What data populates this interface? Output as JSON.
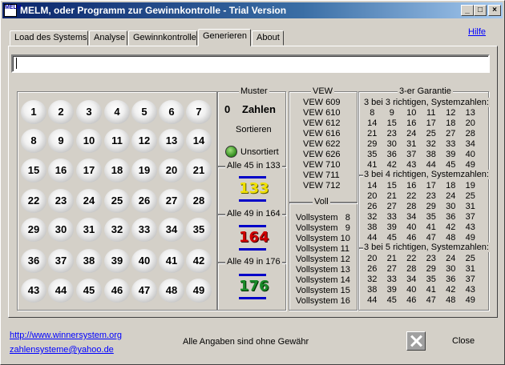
{
  "window": {
    "title": "MELM, oder Programm zur Gewinnkontrolle - Trial Version",
    "icon_text": "MELM",
    "controls": {
      "minimize": "_",
      "maximize": "□",
      "close": "×"
    }
  },
  "tabs": [
    "Load des Systems",
    "Analyse",
    "Gewinnkontrolle",
    "Generieren",
    "About"
  ],
  "active_tab": "Generieren",
  "help_link": "Hilfe",
  "input_value": "",
  "balls": [
    "1",
    "2",
    "3",
    "4",
    "5",
    "6",
    "7",
    "8",
    "9",
    "10",
    "11",
    "12",
    "13",
    "14",
    "15",
    "16",
    "17",
    "18",
    "19",
    "20",
    "21",
    "22",
    "23",
    "24",
    "25",
    "26",
    "27",
    "28",
    "29",
    "30",
    "31",
    "32",
    "33",
    "34",
    "35",
    "36",
    "37",
    "38",
    "39",
    "40",
    "41",
    "42",
    "43",
    "44",
    "45",
    "46",
    "47",
    "48",
    "49"
  ],
  "muster": {
    "header": "Muster",
    "count": "0",
    "count_label": "Zahlen",
    "sortieren": "Sortieren",
    "unsortiert": "Unsortiert",
    "sets": [
      {
        "label": "Alle 45 in 133",
        "badge": "133",
        "color": "#f0e000"
      },
      {
        "label": "Alle 49 in 164",
        "badge": "164",
        "color": "#d00000"
      },
      {
        "label": "Alle 49 in 176",
        "badge": "176",
        "color": "#1a8a2a"
      }
    ]
  },
  "vew": {
    "header": "VEW",
    "items": [
      "VEW 609",
      "VEW 610",
      "VEW 612",
      "VEW 616",
      "VEW 622",
      "VEW 626",
      "VEW 710",
      "VEW 711",
      "VEW 712"
    ]
  },
  "voll": {
    "header": "Voll",
    "items": [
      "Vollsystem   8",
      "Vollsystem   9",
      "Vollsystem 10",
      "Vollsystem 11",
      "Vollsystem 12",
      "Vollsystem 13",
      "Vollsystem 14",
      "Vollsystem 15",
      "Vollsystem 16"
    ]
  },
  "garantie": {
    "header": "3-er Garantie",
    "sections": [
      {
        "title": "3 bei 3 richtigen, Systemzahlen:",
        "rows": [
          [
            "8",
            "9",
            "10",
            "11",
            "12",
            "13"
          ],
          [
            "14",
            "15",
            "16",
            "17",
            "18",
            "20"
          ],
          [
            "21",
            "23",
            "24",
            "25",
            "27",
            "28"
          ],
          [
            "29",
            "30",
            "31",
            "32",
            "33",
            "34"
          ],
          [
            "35",
            "36",
            "37",
            "38",
            "39",
            "40"
          ],
          [
            "41",
            "42",
            "43",
            "44",
            "45",
            "49"
          ]
        ]
      },
      {
        "title": "3 bei 4 richtigen, Systemzahlen:",
        "rows": [
          [
            "14",
            "15",
            "16",
            "17",
            "18",
            "19"
          ],
          [
            "20",
            "21",
            "22",
            "23",
            "24",
            "25"
          ],
          [
            "26",
            "27",
            "28",
            "29",
            "30",
            "31"
          ],
          [
            "32",
            "33",
            "34",
            "35",
            "36",
            "37"
          ],
          [
            "38",
            "39",
            "40",
            "41",
            "42",
            "43"
          ],
          [
            "44",
            "45",
            "46",
            "47",
            "48",
            "49"
          ]
        ]
      },
      {
        "title": "3 bei 5 richtigen, Systemzahlen:",
        "rows": [
          [
            "20",
            "21",
            "22",
            "23",
            "24",
            "25"
          ],
          [
            "26",
            "27",
            "28",
            "29",
            "30",
            "31"
          ],
          [
            "32",
            "33",
            "34",
            "35",
            "36",
            "37"
          ],
          [
            "38",
            "39",
            "40",
            "41",
            "42",
            "43"
          ],
          [
            "44",
            "45",
            "46",
            "47",
            "48",
            "49"
          ]
        ]
      }
    ]
  },
  "footer": {
    "url": "http://www.winnersystem.org",
    "email": "zahlensysteme@yahoo.de",
    "disclaimer": "Alle Angaben sind ohne Gewähr",
    "close_label": "Close"
  }
}
